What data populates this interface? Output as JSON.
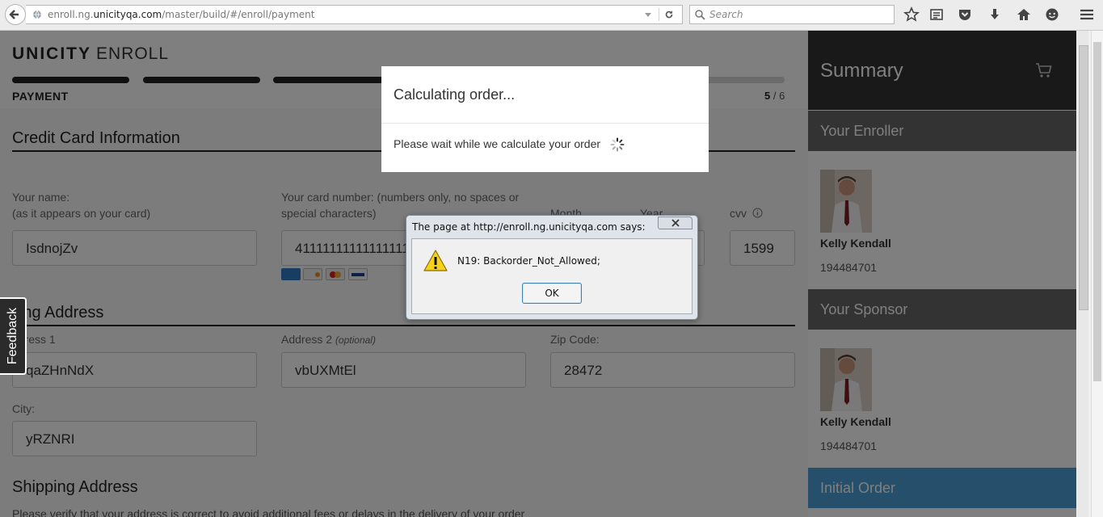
{
  "browser": {
    "url_prefix": "enroll.ng.",
    "url_domain": "unicityqa.com",
    "url_path": "/master/build/#/enroll/payment",
    "search_placeholder": "Search"
  },
  "header": {
    "brand": "UNICITY",
    "product": "ENROLL",
    "step_label": "PAYMENT",
    "step_current": "5",
    "step_total": "/ 6",
    "progress_steps_total": 6,
    "progress_steps_completed": 3
  },
  "credit_card": {
    "title": "Credit Card Information",
    "name_label_1": "Your name:",
    "name_label_2": "(as it appears on your card)",
    "name_value": "IsdnojZv",
    "number_label_1": "Your card number: (numbers only, no spaces or",
    "number_label_2": "special characters)",
    "number_value": "41111111111111111",
    "month_label": "Month",
    "year_label": "Year",
    "cvv_label": "cvv",
    "cvv_value": "1599"
  },
  "billing": {
    "title": "lling Address",
    "address1_label": "ddress 1",
    "address1_value": "qaZHnNdX",
    "address2_label": "Address 2",
    "address2_optional": "(optional)",
    "address2_value": "vbUXMtEl",
    "zip_label": "Zip Code:",
    "zip_value": "28472",
    "city_label": "City:",
    "city_value": "yRZNRI"
  },
  "shipping": {
    "title": "Shipping Address",
    "note": "Please verify that your address is correct to avoid additional fees or delays in the delivery of your order"
  },
  "feedback_label": "Feedback",
  "summary": {
    "title": "Summary",
    "enroller_header": "Your Enroller",
    "enroller_name": "Kelly Kendall",
    "enroller_id": "194484701",
    "sponsor_header": "Your Sponsor",
    "sponsor_name": "Kelly Kendall",
    "sponsor_id": "194484701",
    "initial_order_header": "Initial Order"
  },
  "calc_modal": {
    "title": "Calculating order...",
    "body": "Please wait while we calculate your order"
  },
  "alert": {
    "title": "The page at http://enroll.ng.unicityqa.com says:",
    "message": "N19: Backorder_Not_Allowed;",
    "ok_label": "OK"
  },
  "colors": {
    "summary_bg": "#333333",
    "side_header_bg": "#666666",
    "initial_order_bg": "#4a9fd5",
    "overlay": "rgba(0,0,0,0.5)"
  }
}
